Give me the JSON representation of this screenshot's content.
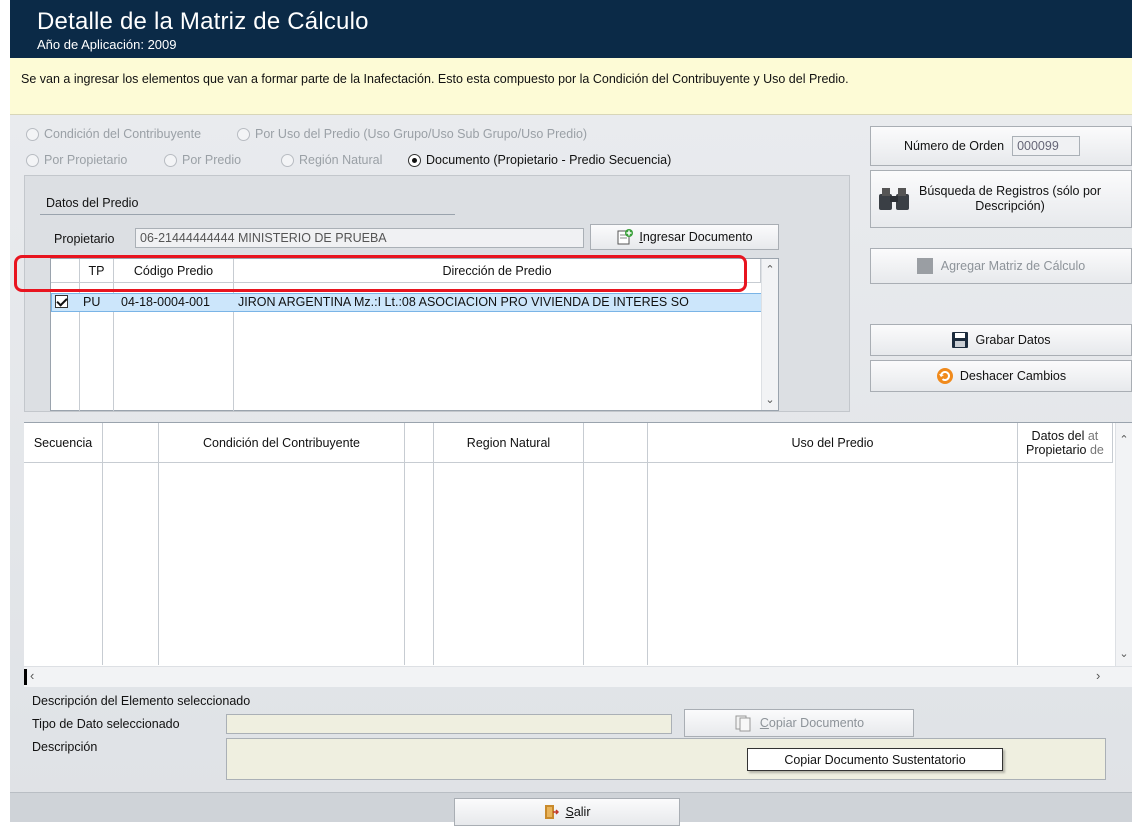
{
  "header": {
    "title": "Detalle de la Matriz de Cálculo",
    "subtitle": "Año de Aplicación: 2009"
  },
  "info_text": "Se van a ingresar los elementos que van a formar parte de la Inafectación. Esto esta compuesto por la Condición del Contribuyente y Uso del Predio.",
  "radios": {
    "condicion": "Condición del Contribuyente",
    "uso": "Por Uso del Predio (Uso Grupo/Uso Sub Grupo/Uso Predio)",
    "propietario": "Por Propietario",
    "predio": "Por Predio",
    "region": "Región Natural",
    "documento": "Documento (Propietario - Predio Secuencia)",
    "selected": "documento"
  },
  "datos_predio": {
    "title": "Datos del Predio",
    "propietario_label": "Propietario",
    "propietario_value": "06-21444444444 MINISTERIO DE PRUEBA",
    "ingresar_button": "Ingresar Documento",
    "ingresar_mnemonic": "I",
    "ingresar_rest": "ngresar Documento",
    "columns": [
      "TP",
      "Código Predio",
      "Dirección de Predio"
    ],
    "rows": [
      {
        "checked": true,
        "tp": "PU",
        "codigo": "04-18-0004-001",
        "direccion": "JIRON ARGENTINA  Mz.:I Lt.:08  ASOCIACION PRO VIVIENDA DE INTERES SO"
      }
    ]
  },
  "right_panel": {
    "orden_label": "Número de Orden",
    "orden_value": "000099",
    "busqueda_line1": "Búsqueda de Registros (sólo por",
    "busqueda_line2": "Descripción)",
    "agregar_button": "Agregar Matriz de Cálculo",
    "grabar_button": "Grabar Datos",
    "deshacer_button": "Deshacer Cambios"
  },
  "grid2": {
    "columns": [
      "Secuencia",
      "Condición del Contribuyente",
      "Region Natural",
      "Uso del Predio"
    ],
    "partial_col_line1": "Datos del",
    "partial_col_line2": "Propietario",
    "partial_col_line1b": "at",
    "partial_col_line2b": "de"
  },
  "bottom": {
    "desc_elemento": "Descripción del Elemento seleccionado",
    "tipo_label": "Tipo de Dato seleccionado",
    "descripcion_label": "Descripción",
    "copiar_button": "Copiar Documento",
    "copiar_mnemonic": "C",
    "copiar_rest": "opiar Documento",
    "tooltip": "Copiar Documento Sustentatorio"
  },
  "footer": {
    "salir_button": "Salir",
    "salir_mnemonic": "S",
    "salir_rest": "alir"
  },
  "colors": {
    "header_bg": "#0b2a47",
    "info_bg": "#fdfbd6",
    "highlight": "#e8141f",
    "selected_row": "#cce6fb"
  }
}
